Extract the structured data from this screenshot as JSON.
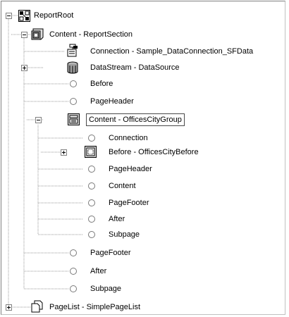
{
  "tree": {
    "root": {
      "label": "ReportRoot",
      "icon": "report-root-icon"
    },
    "content_section": {
      "label": "Content - ReportSection",
      "icon": "report-section-icon"
    },
    "connection_sf": {
      "label": "Connection - Sample_DataConnection_SFData",
      "icon": "data-connection-icon"
    },
    "datastream": {
      "label": "DataStream - DataSource",
      "icon": "datastream-icon"
    },
    "before_1": {
      "label": "Before"
    },
    "pageheader_1": {
      "label": "PageHeader"
    },
    "offices_group": {
      "label": "Content - OfficesCityGroup",
      "icon": "group-icon",
      "selected": true
    },
    "g_connection": {
      "label": "Connection"
    },
    "g_before": {
      "label": "Before - OfficesCityBefore",
      "icon": "frame-icon"
    },
    "g_pageheader": {
      "label": "PageHeader"
    },
    "g_content": {
      "label": "Content"
    },
    "g_pagefooter": {
      "label": "PageFooter"
    },
    "g_after": {
      "label": "After"
    },
    "g_subpage": {
      "label": "Subpage"
    },
    "pagefooter_1": {
      "label": "PageFooter"
    },
    "after_1": {
      "label": "After"
    },
    "subpage_1": {
      "label": "Subpage"
    },
    "pagelist": {
      "label": "PageList - SimplePageList",
      "icon": "page-list-icon"
    }
  }
}
